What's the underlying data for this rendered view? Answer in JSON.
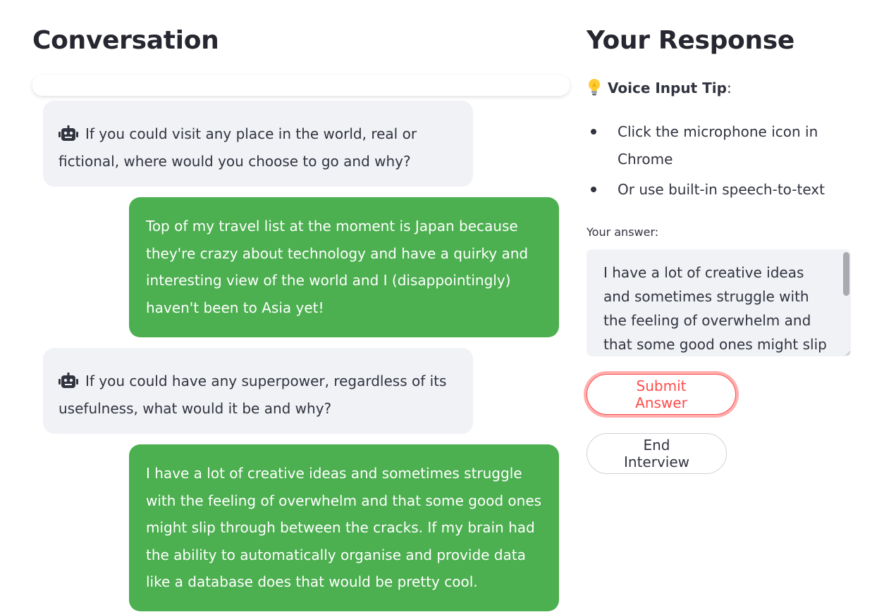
{
  "conversation": {
    "title": "Conversation",
    "messages": [
      {
        "role": "bot",
        "icon": "robot-icon",
        "text": "If you could visit any place in the world, real or fictional, where would you choose to go and why?"
      },
      {
        "role": "user",
        "text": "Top of my travel list at the moment is Japan because they're crazy about technology and have a quirky and interesting view of the world and I (disappointingly) haven't been to Asia yet!"
      },
      {
        "role": "bot",
        "icon": "robot-icon",
        "text": "If you could have any superpower, regardless of its usefulness, what would it be and why?"
      },
      {
        "role": "user",
        "text": "I have a lot of creative ideas and sometimes struggle with the feeling of overwhelm and that some good ones might slip through between the cracks. If my brain had the ability to automatically organise and provide data like a database does that would be pretty cool."
      }
    ]
  },
  "response": {
    "title": "Your Response",
    "tip": {
      "icon": "lightbulb-icon",
      "label": "Voice Input Tip",
      "suffix": ":",
      "items": [
        "Click the microphone icon in Chrome",
        "Or use built-in speech-to-text"
      ]
    },
    "answer_label": "Your answer:",
    "answer_value": "I have a lot of creative ideas and sometimes struggle with the feeling of overwhelm and that some good ones might slip through between the cracks. If my brain had the ability to automatically organise and provide data like a database does that would be pretty cool.",
    "submit_label": "Submit Answer",
    "end_label": "End Interview"
  },
  "colors": {
    "user_bubble": "#4caf50",
    "bot_bubble": "#f0f2f6",
    "accent": "#ff4b4b"
  }
}
